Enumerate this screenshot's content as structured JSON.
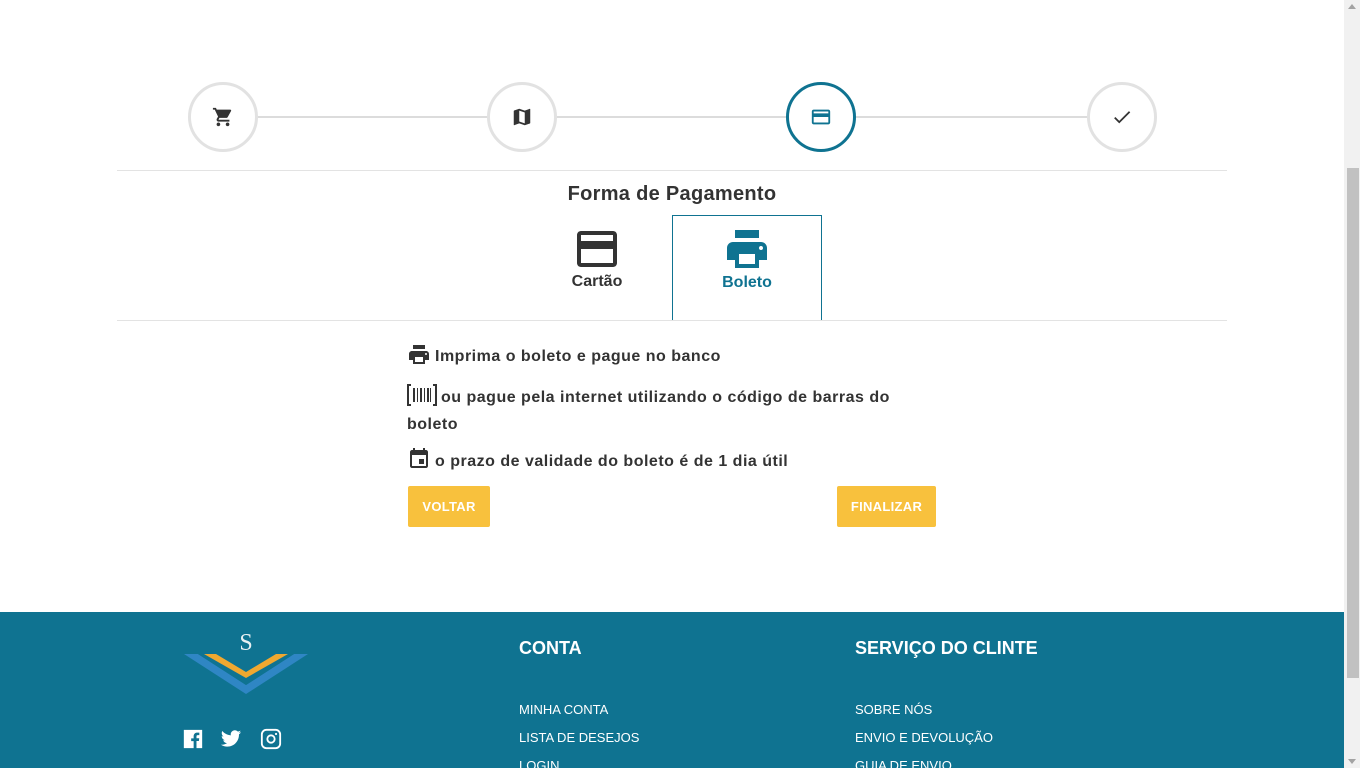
{
  "colors": {
    "accent": "#0f7391",
    "button": "#f8c13d",
    "footer_bg": "#0f7391",
    "step_inactive": "#e2e2e2"
  },
  "stepper": {
    "steps": [
      {
        "icon": "cart-icon",
        "state": "done"
      },
      {
        "icon": "map-icon",
        "state": "done"
      },
      {
        "icon": "credit-card-icon",
        "state": "active"
      },
      {
        "icon": "checkmark-icon",
        "state": "pending"
      }
    ]
  },
  "payment": {
    "title": "Forma de Pagamento",
    "tabs": [
      {
        "label": "Cartão",
        "icon": "credit-card-icon",
        "active": false
      },
      {
        "label": "Boleto",
        "icon": "printer-icon",
        "active": true
      }
    ],
    "info": [
      {
        "icon": "printer-icon",
        "text": "Imprima o boleto e pague no banco"
      },
      {
        "icon": "barcode-icon",
        "text": "ou pague pela internet utilizando o código de barras do boleto"
      },
      {
        "icon": "calendar-icon",
        "text": "o prazo de validade do boleto é de 1 dia útil"
      }
    ],
    "back_label": "VOLTAR",
    "finish_label": "FINALIZAR"
  },
  "footer": {
    "logo_letter": "S",
    "social": [
      "facebook-icon",
      "twitter-icon",
      "instagram-icon"
    ],
    "columns": [
      {
        "heading": "CONTA",
        "links": [
          "MINHA CONTA",
          "LISTA DE DESEJOS",
          "LOGIN"
        ]
      },
      {
        "heading": "SERVIÇO DO CLINTE",
        "links": [
          "SOBRE NÓS",
          "ENVIO E DEVOLUÇÃO",
          "GUIA DE ENVIO"
        ]
      }
    ]
  }
}
